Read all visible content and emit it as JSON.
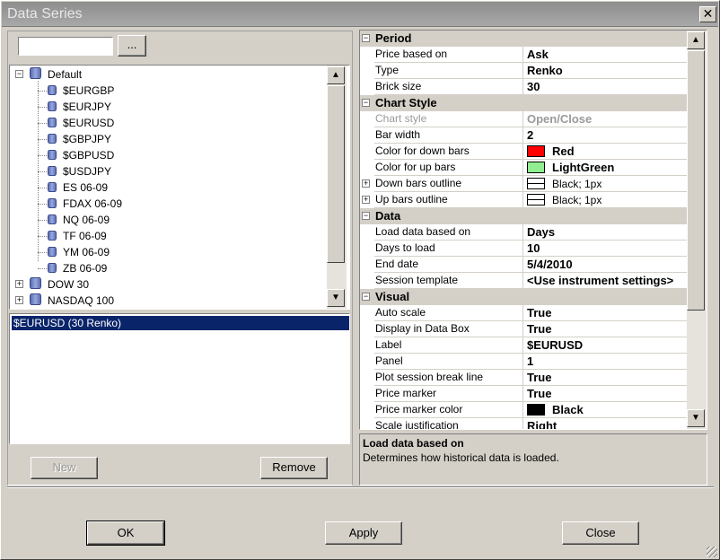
{
  "window": {
    "title": "Data Series",
    "close_glyph": "✕"
  },
  "left": {
    "search_value": "",
    "browse_label": "...",
    "tree": [
      {
        "label": "Default",
        "level": 0,
        "expanded": true
      },
      {
        "label": "$EURGBP",
        "level": 1
      },
      {
        "label": "$EURJPY",
        "level": 1
      },
      {
        "label": "$EURUSD",
        "level": 1
      },
      {
        "label": "$GBPJPY",
        "level": 1
      },
      {
        "label": "$GBPUSD",
        "level": 1
      },
      {
        "label": "$USDJPY",
        "level": 1
      },
      {
        "label": "ES 06-09",
        "level": 1
      },
      {
        "label": "FDAX 06-09",
        "level": 1
      },
      {
        "label": "NQ 06-09",
        "level": 1
      },
      {
        "label": "TF 06-09",
        "level": 1
      },
      {
        "label": "YM 06-09",
        "level": 1
      },
      {
        "label": "ZB 06-09",
        "level": 1
      },
      {
        "label": "DOW 30",
        "level": 0,
        "expanded": false
      },
      {
        "label": "NASDAQ 100",
        "level": 0,
        "expanded": false
      }
    ],
    "series": [
      {
        "label": "$EURUSD (30 Renko)",
        "selected": true
      }
    ],
    "new_label": "New",
    "remove_label": "Remove"
  },
  "grid": {
    "categories": [
      {
        "name": "Period",
        "rows": [
          {
            "name": "Price based on",
            "value": "Ask"
          },
          {
            "name": "Type",
            "value": "Renko"
          },
          {
            "name": "Brick size",
            "value": "30"
          }
        ]
      },
      {
        "name": "Chart Style",
        "rows": [
          {
            "name": "Chart style",
            "value": "Open/Close",
            "disabled": true
          },
          {
            "name": "Bar width",
            "value": "2"
          },
          {
            "name": "Color for down bars",
            "value": "Red",
            "swatch": "#ff0000"
          },
          {
            "name": "Color for up bars",
            "value": "LightGreen",
            "swatch": "#90ee90"
          },
          {
            "name": "Down bars outline",
            "value": "Black; 1px",
            "outline": true,
            "expandable": true
          },
          {
            "name": "Up bars outline",
            "value": "Black; 1px",
            "outline": true,
            "expandable": true
          }
        ]
      },
      {
        "name": "Data",
        "rows": [
          {
            "name": "Load data based on",
            "value": "Days"
          },
          {
            "name": "Days to load",
            "value": "10"
          },
          {
            "name": "End date",
            "value": "5/4/2010"
          },
          {
            "name": "Session template",
            "value": "<Use instrument settings>"
          }
        ]
      },
      {
        "name": "Visual",
        "rows": [
          {
            "name": "Auto scale",
            "value": "True"
          },
          {
            "name": "Display in Data Box",
            "value": "True"
          },
          {
            "name": "Label",
            "value": "$EURUSD"
          },
          {
            "name": "Panel",
            "value": "1"
          },
          {
            "name": "Plot session break line",
            "value": "True"
          },
          {
            "name": "Price marker",
            "value": "True"
          },
          {
            "name": "Price marker color",
            "value": "Black",
            "swatch": "#000000"
          },
          {
            "name": "Scale justification",
            "value": "Right"
          }
        ]
      }
    ]
  },
  "description": {
    "title": "Load data based on",
    "text": "Determines how historical data is loaded."
  },
  "footer": {
    "ok_label": "OK",
    "apply_label": "Apply",
    "close_label": "Close"
  },
  "glyphs": {
    "scroll_up": "▲",
    "scroll_down": "▼",
    "minus": "−",
    "plus": "+"
  }
}
